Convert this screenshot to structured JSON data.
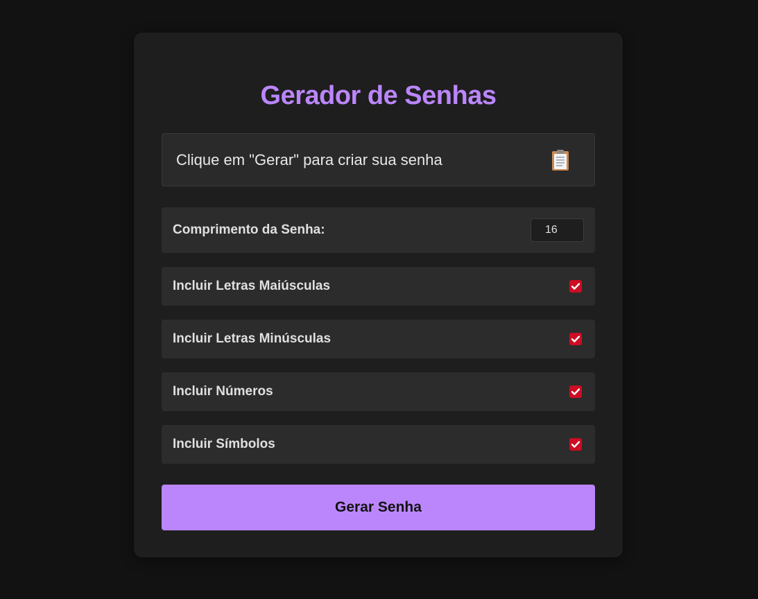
{
  "app": {
    "title": "Gerador de Senhas"
  },
  "output": {
    "text": "Clique em \"Gerar\" para criar sua senha",
    "copy_icon": "clipboard-icon"
  },
  "length": {
    "label": "Comprimento da Senha:",
    "value": "16"
  },
  "options": [
    {
      "label": "Incluir Letras Maiúsculas",
      "checked": true
    },
    {
      "label": "Incluir Letras Minúsculas",
      "checked": true
    },
    {
      "label": "Incluir Números",
      "checked": true
    },
    {
      "label": "Incluir Símbolos",
      "checked": true
    }
  ],
  "generate": {
    "label": "Gerar Senha"
  },
  "colors": {
    "background": "#121212",
    "card": "#1e1e1e",
    "accent": "#bb86fc",
    "checkbox": "#cc0d24"
  }
}
